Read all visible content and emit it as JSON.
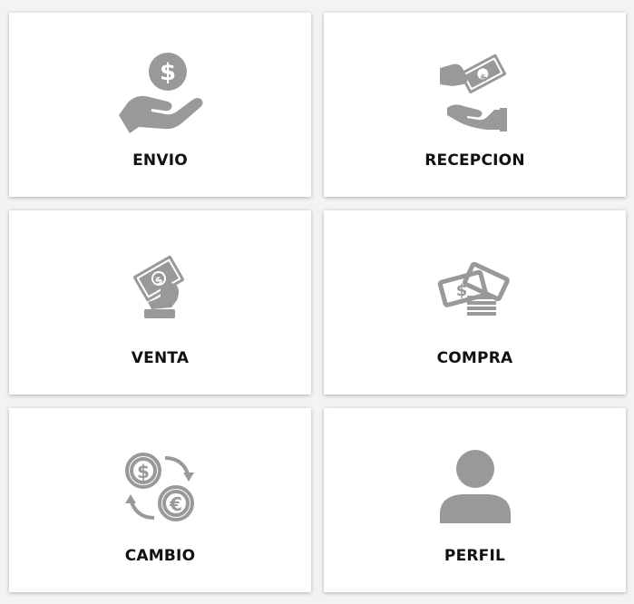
{
  "icon_color": "#999999",
  "cards": [
    {
      "label": "ENVIO",
      "icon": "hand-coin-icon"
    },
    {
      "label": "RECEPCION",
      "icon": "receive-money-icon"
    },
    {
      "label": "VENTA",
      "icon": "hand-banknote-icon"
    },
    {
      "label": "COMPRA",
      "icon": "money-stack-icon"
    },
    {
      "label": "CAMBIO",
      "icon": "currency-exchange-icon"
    },
    {
      "label": "PERFIL",
      "icon": "user-profile-icon"
    }
  ]
}
